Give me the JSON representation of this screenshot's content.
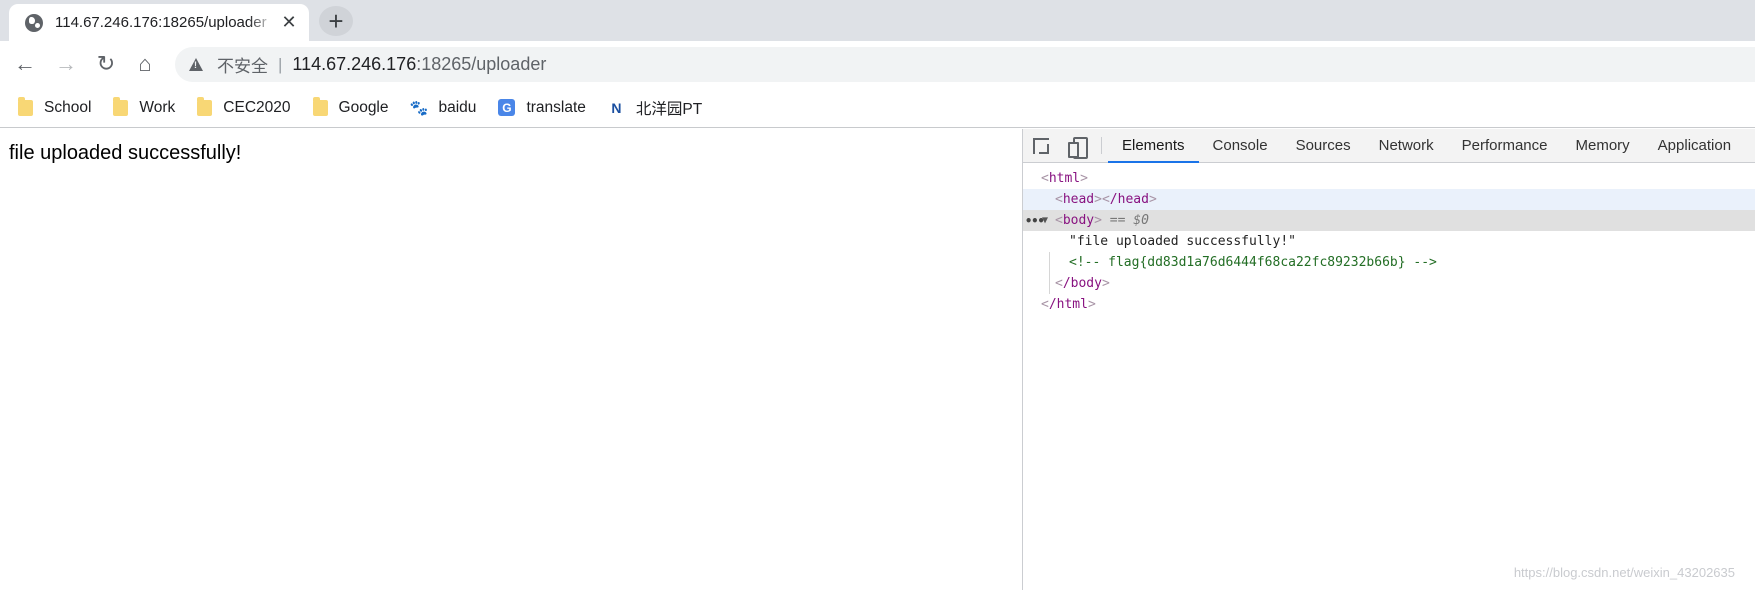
{
  "tab": {
    "title": "114.67.246.176:18265/uploader",
    "close": "✕",
    "new_tab": "+"
  },
  "toolbar": {
    "back": "←",
    "forward": "→",
    "reload": "↻",
    "home": "⌂",
    "security_label": "不安全",
    "separator": "|",
    "url_host": "114.67.246.176",
    "url_rest": ":18265/uploader"
  },
  "bookmarks": [
    {
      "label": "School",
      "icon": "folder-icon"
    },
    {
      "label": "Work",
      "icon": "folder-icon"
    },
    {
      "label": "CEC2020",
      "icon": "folder-icon"
    },
    {
      "label": "Google",
      "icon": "folder-icon"
    },
    {
      "label": "baidu",
      "icon": "baidu-icon"
    },
    {
      "label": "translate",
      "icon": "translate-icon"
    },
    {
      "label": "北洋园PT",
      "icon": "beiyang-icon"
    }
  ],
  "page": {
    "message": "file uploaded successfully!"
  },
  "devtools": {
    "tabs": [
      "Elements",
      "Console",
      "Sources",
      "Network",
      "Performance",
      "Memory",
      "Application"
    ],
    "active_tab": "Elements",
    "dom": {
      "html_open": "html",
      "head_open": "head",
      "head_close": "/head",
      "body_open": "body",
      "selected_marker": "== $0",
      "body_text": "\"file uploaded successfully!\"",
      "comment": "<!-- flag{dd83d1a76d6444f68ca22fc89232b66b} -->",
      "body_close": "/body",
      "html_close": "/html"
    }
  },
  "watermark": "https://blog.csdn.net/weixin_43202635"
}
